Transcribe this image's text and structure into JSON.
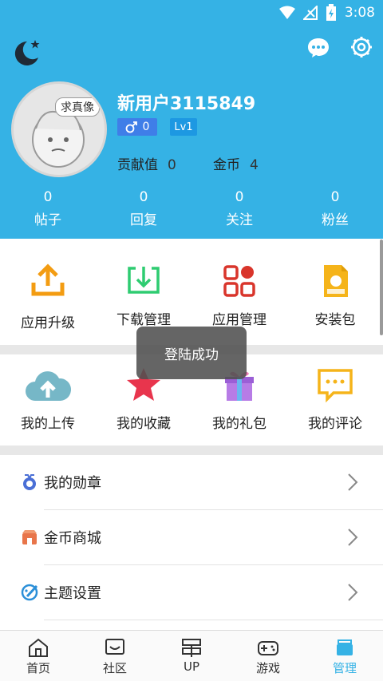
{
  "status_bar": {
    "time": "3:08"
  },
  "header": {
    "username": "新用户3115849",
    "avatar_badge": "求真像",
    "gender_count": "0",
    "level": "Lv1",
    "contribution_label": "贡献值",
    "contribution_value": "0",
    "coins_label": "金币",
    "coins_value": "4",
    "stats": [
      {
        "num": "0",
        "label": "帖子"
      },
      {
        "num": "0",
        "label": "回复"
      },
      {
        "num": "0",
        "label": "关注"
      },
      {
        "num": "0",
        "label": "粉丝"
      }
    ]
  },
  "grid1": [
    {
      "label": "应用升级",
      "icon": "upload-icon"
    },
    {
      "label": "下载管理",
      "icon": "download-icon"
    },
    {
      "label": "应用管理",
      "icon": "apps-icon"
    },
    {
      "label": "安装包",
      "icon": "apk-icon"
    }
  ],
  "grid2": [
    {
      "label": "我的上传",
      "icon": "cloud-upload-icon"
    },
    {
      "label": "我的收藏",
      "icon": "star-icon"
    },
    {
      "label": "我的礼包",
      "icon": "gift-icon"
    },
    {
      "label": "我的评论",
      "icon": "comment-icon"
    }
  ],
  "list": [
    {
      "label": "我的勋章",
      "icon": "medal-icon"
    },
    {
      "label": "金币商城",
      "icon": "shop-icon"
    },
    {
      "label": "主题设置",
      "icon": "palette-icon"
    }
  ],
  "toast": "登陆成功",
  "bottom_nav": [
    {
      "label": "首页",
      "icon": "home-icon"
    },
    {
      "label": "社区",
      "icon": "community-icon"
    },
    {
      "label": "UP",
      "icon": "up-icon"
    },
    {
      "label": "游戏",
      "icon": "gamepad-icon"
    },
    {
      "label": "管理",
      "icon": "manage-icon",
      "active": true
    }
  ],
  "colors": {
    "primary": "#35b2e5",
    "accent_orange": "#f39c12",
    "accent_green": "#2ecc71",
    "accent_red": "#e74c3c"
  }
}
